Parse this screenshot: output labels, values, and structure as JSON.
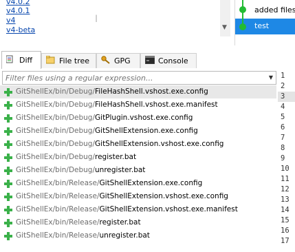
{
  "branches": [
    "v4.0.2",
    "v4.0.1",
    "v4",
    "v4-beta"
  ],
  "commits": [
    {
      "label": "added files",
      "selected": false
    },
    {
      "label": "test",
      "selected": true
    }
  ],
  "tabs": [
    {
      "label": "Diff",
      "icon": "diff-icon",
      "active": true
    },
    {
      "label": "File tree",
      "icon": "file-tree-icon",
      "active": false
    },
    {
      "label": "GPG",
      "icon": "key-icon",
      "active": false
    },
    {
      "label": "Console",
      "icon": "console-icon",
      "active": false
    }
  ],
  "filter": {
    "placeholder": "Filter files using a regular expression..."
  },
  "files": [
    {
      "path": "GitShellEx/bin/Debug/",
      "name": "FileHashShell.vshost.exe.config",
      "selected": true
    },
    {
      "path": "GitShellEx/bin/Debug/",
      "name": "FileHashShell.vshost.exe.manifest",
      "selected": false
    },
    {
      "path": "GitShellEx/bin/Debug/",
      "name": "GitPlugin.vshost.exe.config",
      "selected": false
    },
    {
      "path": "GitShellEx/bin/Debug/",
      "name": "GitShellExtension.exe.config",
      "selected": false
    },
    {
      "path": "GitShellEx/bin/Debug/",
      "name": "GitShellExtension.vshost.exe.config",
      "selected": false
    },
    {
      "path": "GitShellEx/bin/Debug/",
      "name": "register.bat",
      "selected": false
    },
    {
      "path": "GitShellEx/bin/Debug/",
      "name": "unregister.bat",
      "selected": false
    },
    {
      "path": "GitShellEx/bin/Release/",
      "name": "GitShellExtension.exe.config",
      "selected": false
    },
    {
      "path": "GitShellEx/bin/Release/",
      "name": "GitShellExtension.vshost.exe.config",
      "selected": false
    },
    {
      "path": "GitShellEx/bin/Release/",
      "name": "GitShellExtension.vshost.exe.manifest",
      "selected": false
    },
    {
      "path": "GitShellEx/bin/Release/",
      "name": "register.bat",
      "selected": false
    },
    {
      "path": "GitShellEx/bin/Release/",
      "name": "unregister.bat",
      "selected": false
    }
  ],
  "line_numbers": [
    "1",
    "2",
    "3",
    "4",
    "5",
    "6",
    "7",
    "8",
    "9",
    "10",
    "11",
    "12",
    "13",
    "14",
    "15",
    "16",
    "17"
  ],
  "highlighted_line": "3",
  "colors": {
    "added": "#3bb14a",
    "selection": "#1e88e5",
    "graph": "#22bb33",
    "link": "#0645ad"
  }
}
